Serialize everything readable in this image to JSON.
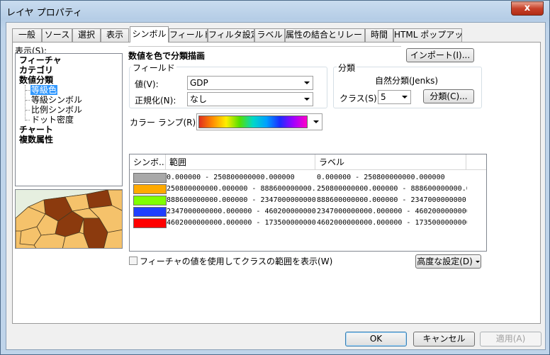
{
  "window": {
    "title": "レイヤ プロパティ",
    "close_glyph": "x"
  },
  "tabs": [
    {
      "label": "一般"
    },
    {
      "label": "ソース"
    },
    {
      "label": "選択"
    },
    {
      "label": "表示"
    },
    {
      "label": "シンボル"
    },
    {
      "label": "フィールド"
    },
    {
      "label": "フィルタ設定"
    },
    {
      "label": "ラベル"
    },
    {
      "label": "属性の結合とリレート"
    },
    {
      "label": "時間"
    },
    {
      "label": "HTML ポップアップ"
    }
  ],
  "active_tab": "シンボル",
  "show": {
    "label": "表示(S):",
    "tree": [
      {
        "label": "フィーチャ",
        "bold": true
      },
      {
        "label": "カテゴリ",
        "bold": true
      },
      {
        "label": "数値分類",
        "bold": true
      },
      {
        "label": "等級色",
        "selected": true
      },
      {
        "label": "等級シンボル"
      },
      {
        "label": "比例シンボル"
      },
      {
        "label": "ドット密度"
      },
      {
        "label": "チャート",
        "bold": true
      },
      {
        "label": "複数属性",
        "bold": true
      }
    ]
  },
  "header": {
    "title": "数値を色で分類描画",
    "import_button": "インポート(I)..."
  },
  "fields": {
    "group_label": "フィールド",
    "value_label": "値(V):",
    "value": "GDP",
    "normalize_label": "正規化(N):",
    "normalize": "なし"
  },
  "classification": {
    "group_label": "分類",
    "method": "自然分類(Jenks)",
    "classes_label": "クラス(S):",
    "classes": "5",
    "classify_button": "分類(C)..."
  },
  "color_ramp": {
    "label": "カラー ランプ(R):"
  },
  "table": {
    "headers": {
      "symbol": "シンボ...",
      "range": "範囲",
      "label": "ラベル"
    },
    "rows": [
      {
        "color": "#a8a8a8",
        "range": "0.000000 - 250800000000.000000",
        "label": "0.000000 - 250800000000.000000"
      },
      {
        "color": "#ffaa00",
        "range": "250800000000.000000 - 888600000000.00",
        "label": "250800000000.000000 - 888600000000.00"
      },
      {
        "color": "#7fff00",
        "range": "888600000000.000000 - 2347000000000.0",
        "label": "888600000000.000000 - 2347000000000.0"
      },
      {
        "color": "#1f3fff",
        "range": "2347000000000.000000 - 4602000000000.",
        "label": "2347000000000.000000 - 4602000000000."
      },
      {
        "color": "#ff0000",
        "range": "4602000000000.000000 - 17350000000000",
        "label": "4602000000000.000000 - 17350000000000"
      }
    ]
  },
  "show_feature_values": {
    "label": "フィーチャの値を使用してクラスの範囲を表示(W)",
    "checked": false
  },
  "advanced_button": "高度な設定(D)",
  "footer": {
    "ok": "OK",
    "cancel": "キャンセル",
    "apply": "適用(A)"
  }
}
